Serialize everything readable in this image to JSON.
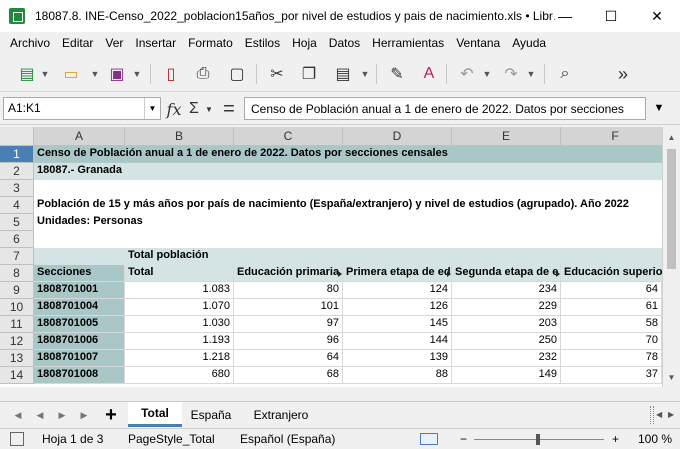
{
  "window": {
    "title": "18087.8. INE-Censo_2022_poblacion15años_por nivel de estudios y pais de nacimiento.xls • Libr…",
    "minimize": "—",
    "maximize": "☐",
    "close": "✕"
  },
  "menu": [
    "Archivo",
    "Editar",
    "Ver",
    "Insertar",
    "Formato",
    "Estilos",
    "Hoja",
    "Datos",
    "Herramientas",
    "Ventana",
    "Ayuda"
  ],
  "toolbar": {
    "icons": [
      "new-spreadsheet-icon",
      "open-folder-icon",
      "save-icon",
      "export-pdf-icon",
      "print-icon",
      "print-preview-icon",
      "cut-icon",
      "copy-icon",
      "paste-icon",
      "clone-formatting-icon",
      "clear-formatting-icon",
      "undo-icon",
      "redo-icon",
      "find-replace-icon"
    ],
    "more": "»"
  },
  "formula_bar": {
    "name_box": "A1:K1",
    "fx": "fx",
    "sum": "Σ",
    "equals": "=",
    "content": "Censo de Población anual a 1 de enero de 2022. Datos por secciones"
  },
  "columns": [
    "A",
    "B",
    "C",
    "D",
    "E",
    "F"
  ],
  "rows": [
    "1",
    "2",
    "3",
    "4",
    "5",
    "6",
    "7",
    "8",
    "9",
    "10",
    "11",
    "12",
    "13",
    "14"
  ],
  "sheet": {
    "r1": "Censo de Población anual a 1 de enero de 2022. Datos por secciones censales",
    "r2": "18087.- Granada",
    "r4": "Población de 15 y más años por país de nacimiento (España/extranjero) y nivel de estudios (agrupado). Año 2022",
    "r5": "Unidades: Personas",
    "r7_b": "Total población",
    "headers": [
      "Secciones",
      "Total",
      "Educación primaria",
      "Primera etapa de ed",
      "Segunda etapa de e",
      "Educación superior"
    ],
    "data": [
      [
        "1808701001",
        "1.083",
        "80",
        "124",
        "234",
        "64"
      ],
      [
        "1808701004",
        "1.070",
        "101",
        "126",
        "229",
        "61"
      ],
      [
        "1808701005",
        "1.030",
        "97",
        "145",
        "203",
        "58"
      ],
      [
        "1808701006",
        "1.193",
        "96",
        "144",
        "250",
        "70"
      ],
      [
        "1808701007",
        "1.218",
        "64",
        "139",
        "232",
        "78"
      ],
      [
        "1808701008",
        "680",
        "68",
        "88",
        "149",
        "37"
      ]
    ]
  },
  "tabs": {
    "add": "+",
    "items": [
      "Total",
      "España",
      "Extranjero"
    ],
    "active": "Total"
  },
  "status": {
    "sheet": "Hoja 1 de 3",
    "page_style": "PageStyle_Total",
    "language": "Español (España)",
    "zoom_minus": "−",
    "zoom_plus": "+",
    "zoom": "100 %"
  },
  "colors": {
    "title_fill": "#aac7c7",
    "light_fill": "#d4e4e4",
    "selection": "#4a7fb5"
  }
}
